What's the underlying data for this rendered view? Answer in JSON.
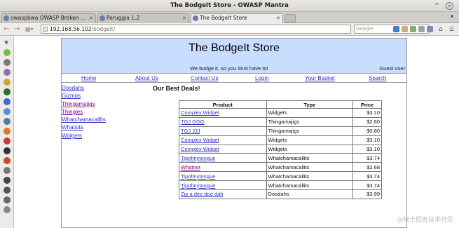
{
  "window": {
    "title": "The BodgeIt Store - OWASP Mantra"
  },
  "tabs": [
    {
      "label": "owaspbwa OWASP Broken ..."
    },
    {
      "label": "Peruggia 1.2"
    },
    {
      "label": "The BodgeIt Store"
    }
  ],
  "navbar": {
    "url_host": "192.168.56.102",
    "url_path": "/bodgeit/",
    "search_engine": "Google"
  },
  "site": {
    "title": "The BodgeIt Store",
    "tagline": "We bodge it, so you dont have to!",
    "user": "Guest user",
    "menu": [
      "Home",
      "About Us",
      "Contact Us",
      "Login",
      "Your Basket",
      "Search"
    ],
    "categories": [
      "Doodahs",
      "Gizmos",
      "Thingamajigs",
      "Thingies",
      "Whatchamacallits",
      "Whatsits",
      "Widgets"
    ],
    "deals_title": "Our Best Deals!",
    "table_headers": [
      "Product",
      "Type",
      "Price"
    ],
    "deals": [
      {
        "product": "Complex Widget",
        "type": "Widgets",
        "price": "$3.10"
      },
      {
        "product": "TGJ GGG",
        "type": "Thingamajigs",
        "price": "$2.60"
      },
      {
        "product": "TGJ JJJ",
        "type": "Thingamajigs",
        "price": "$0.80"
      },
      {
        "product": "Complex Widget",
        "type": "Widgets",
        "price": "$3.10"
      },
      {
        "product": "Complex Widget",
        "type": "Widgets",
        "price": "$3.10"
      },
      {
        "product": "Tipofmytongue",
        "type": "Whatchamacallits",
        "price": "$3.74"
      },
      {
        "product": "Whatnot",
        "type": "Whatchamacallits",
        "price": "$2.68"
      },
      {
        "product": "Tipofmytongue",
        "type": "Whatchamacallits",
        "price": "$3.74"
      },
      {
        "product": "Tipofmytongue",
        "type": "Whatchamacallits",
        "price": "$3.74"
      },
      {
        "product": "Zip a dee doo dah",
        "type": "Doodahs",
        "price": "$3.99"
      }
    ]
  },
  "watermark": "@稀土掘金技术社区",
  "colors": {
    "header_bg": "#c9ddff",
    "link": "#3333cc",
    "visited_link": "#800080"
  }
}
